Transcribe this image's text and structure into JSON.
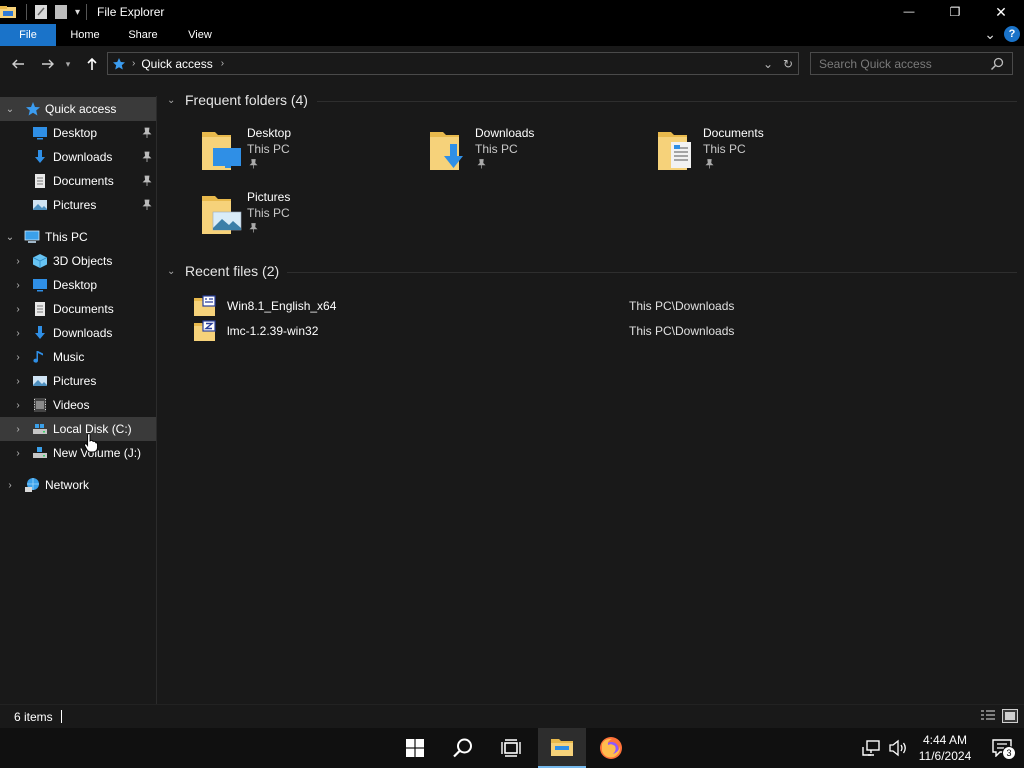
{
  "window": {
    "title": "File Explorer",
    "minimize_glyph": "—",
    "restore_glyph": "❐",
    "close_glyph": "✕"
  },
  "ribbon": {
    "tabs": [
      "File",
      "Home",
      "Share",
      "View"
    ],
    "collapse_glyph": "⌄",
    "help_label": "?"
  },
  "address": {
    "crumb": "Quick access",
    "search_placeholder": "Search Quick access"
  },
  "nav": {
    "quick_access": {
      "label": "Quick access"
    },
    "qa_items": [
      {
        "label": "Desktop",
        "icon": "desktop-icon"
      },
      {
        "label": "Downloads",
        "icon": "downloads-icon"
      },
      {
        "label": "Documents",
        "icon": "documents-icon"
      },
      {
        "label": "Pictures",
        "icon": "pictures-icon"
      }
    ],
    "this_pc": {
      "label": "This PC"
    },
    "pc_items": [
      {
        "label": "3D Objects",
        "icon": "3d-objects-icon"
      },
      {
        "label": "Desktop",
        "icon": "desktop-icon"
      },
      {
        "label": "Documents",
        "icon": "documents-icon"
      },
      {
        "label": "Downloads",
        "icon": "downloads-icon"
      },
      {
        "label": "Music",
        "icon": "music-icon"
      },
      {
        "label": "Pictures",
        "icon": "pictures-icon"
      },
      {
        "label": "Videos",
        "icon": "videos-icon"
      },
      {
        "label": "Local Disk (C:)",
        "icon": "local-disk-icon"
      },
      {
        "label": "New Volume (J:)",
        "icon": "drive-icon"
      }
    ],
    "network": {
      "label": "Network"
    }
  },
  "content": {
    "frequent_title": "Frequent folders (4)",
    "frequent": [
      {
        "name": "Desktop",
        "location": "This PC"
      },
      {
        "name": "Downloads",
        "location": "This PC"
      },
      {
        "name": "Documents",
        "location": "This PC"
      },
      {
        "name": "Pictures",
        "location": "This PC"
      }
    ],
    "recent_title": "Recent files (2)",
    "recent": [
      {
        "name": "Win8.1_English_x64",
        "path": "This PC\\Downloads"
      },
      {
        "name": "lmc-1.2.39-win32",
        "path": "This PC\\Downloads"
      }
    ]
  },
  "status": {
    "items": "6 items"
  },
  "taskbar": {
    "time": "4:44 AM",
    "date": "11/6/2024",
    "notification_count": "3"
  },
  "colors": {
    "accent": "#1a73c9",
    "background": "#191919",
    "selection": "#3a3a3a",
    "folder": "#f6d27a"
  }
}
